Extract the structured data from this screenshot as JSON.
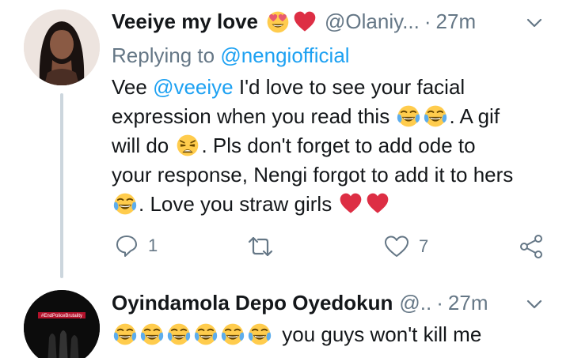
{
  "tweet1": {
    "name": "Veeiye my love",
    "handle": "@Olaniy...",
    "dot": "·",
    "time": "27m",
    "replying_prefix": "Replying to",
    "replying_to": "@nengiofficial",
    "body": {
      "t1": "Vee ",
      "mention": "@veeiye",
      "t2": " I'd love to see your facial",
      "t3": "expression when you read this ",
      "t4": ". A gif",
      "t5": "will do ",
      "t6": ". Pls don't forget to add ode to",
      "t7": "your response, Nengi forgot to add it to hers",
      "t8": ". Love you straw girls "
    },
    "reply_count": "1",
    "retweet_count": "",
    "like_count": "7"
  },
  "tweet2": {
    "name": "Oyindamola Depo Oyedokun",
    "handle": "@..",
    "dot": "·",
    "time": "27m",
    "body_text": "you guys won't kill me",
    "avatar_text": "#EndPoliceBrutality"
  },
  "colors": {
    "text": "#14171a",
    "secondary": "#657786",
    "link": "#1da1f2",
    "divider": "#ccd6dd",
    "heart": "#e0245e"
  },
  "icons": [
    "heart-eyes-emoji",
    "red-heart-emoji",
    "chevron-down-icon",
    "tears-of-joy-emoji",
    "weary-face-emoji",
    "reply-icon",
    "retweet-icon",
    "like-icon",
    "share-icon"
  ]
}
